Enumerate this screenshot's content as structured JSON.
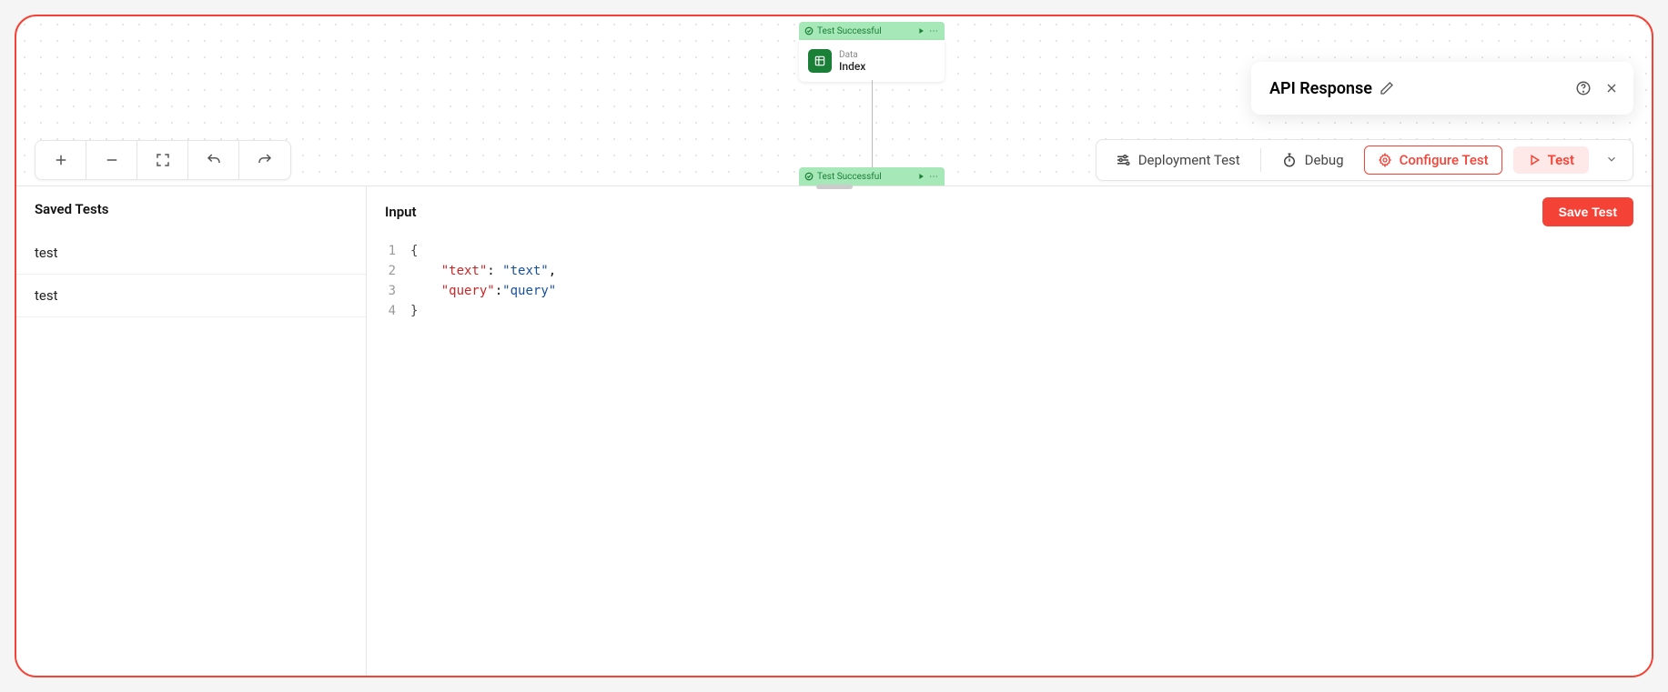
{
  "workflow": {
    "nodes": [
      {
        "status": "Test Successful",
        "subtitle": "Data",
        "title": "Index"
      },
      {
        "status": "Test Successful"
      }
    ]
  },
  "api_popup": {
    "title": "API Response"
  },
  "toolbar": {
    "deployment_test": "Deployment Test",
    "debug": "Debug",
    "configure_test": "Configure Test",
    "test": "Test"
  },
  "sidebar": {
    "heading": "Saved Tests",
    "items": [
      "test",
      "test"
    ]
  },
  "input_panel": {
    "heading": "Input",
    "save_button": "Save Test",
    "code": {
      "lines": [
        "1",
        "2",
        "3",
        "4"
      ],
      "content": [
        {
          "open_brace": "{"
        },
        {
          "key": "\"text\"",
          "colon": ": ",
          "value": "\"text\"",
          "comma": ","
        },
        {
          "key": "\"query\"",
          "colon": ":",
          "value": "\"query\""
        },
        {
          "close_brace": "}"
        }
      ]
    }
  }
}
